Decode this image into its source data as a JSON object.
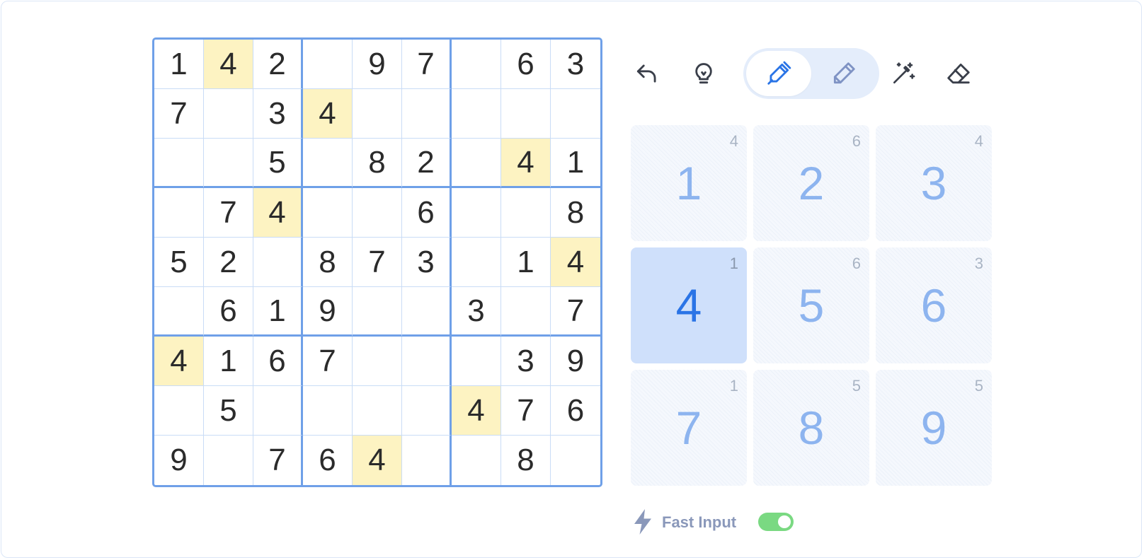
{
  "board": {
    "rows": [
      [
        "1",
        "4",
        "2",
        "",
        "9",
        "7",
        "",
        "6",
        "3"
      ],
      [
        "7",
        "",
        "3",
        "4",
        "",
        "",
        "",
        "",
        ""
      ],
      [
        "",
        "",
        "5",
        "",
        "8",
        "2",
        "",
        "4",
        "1"
      ],
      [
        "",
        "7",
        "4",
        "",
        "",
        "6",
        "",
        "",
        "8"
      ],
      [
        "5",
        "2",
        "",
        "8",
        "7",
        "3",
        "",
        "1",
        "4"
      ],
      [
        "",
        "6",
        "1",
        "9",
        "",
        "",
        "3",
        "",
        "7"
      ],
      [
        "4",
        "1",
        "6",
        "7",
        "",
        "",
        "",
        "3",
        "9"
      ],
      [
        "",
        "5",
        "",
        "",
        "",
        "",
        "4",
        "7",
        "6"
      ],
      [
        "9",
        "",
        "7",
        "6",
        "4",
        "",
        "",
        "8",
        ""
      ]
    ],
    "highlight_digit": "4"
  },
  "toolbar": {
    "icons": {
      "undo": "undo-icon",
      "hint": "lightbulb-icon",
      "pen": "pen-icon",
      "pencil": "pencil-icon",
      "auto_notes": "magic-wand-icon",
      "erase": "eraser-icon"
    },
    "active_mode": "pen"
  },
  "numpad": {
    "selected": "4",
    "keys": [
      {
        "digit": "1",
        "remaining": "4"
      },
      {
        "digit": "2",
        "remaining": "6"
      },
      {
        "digit": "3",
        "remaining": "4"
      },
      {
        "digit": "4",
        "remaining": "1"
      },
      {
        "digit": "5",
        "remaining": "6"
      },
      {
        "digit": "6",
        "remaining": "3"
      },
      {
        "digit": "7",
        "remaining": "1"
      },
      {
        "digit": "8",
        "remaining": "5"
      },
      {
        "digit": "9",
        "remaining": "5"
      }
    ]
  },
  "fast_input": {
    "label": "Fast Input",
    "enabled": true,
    "icon": "lightning-bolt-icon"
  },
  "colors": {
    "accent": "#2a74e6",
    "grid_line": "#6fa0e8",
    "highlight": "#fdf3c2",
    "toggle_on": "#7ad982"
  }
}
